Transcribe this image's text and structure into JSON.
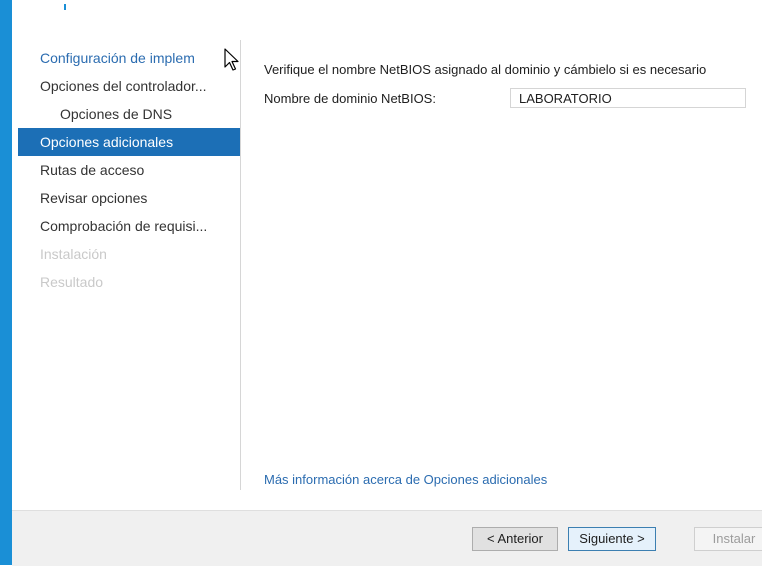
{
  "nav": {
    "items": [
      {
        "label": "Configuración de implem"
      },
      {
        "label": "Opciones del controlador..."
      },
      {
        "label": "Opciones de DNS"
      },
      {
        "label": "Opciones adicionales"
      },
      {
        "label": "Rutas de acceso"
      },
      {
        "label": "Revisar opciones"
      },
      {
        "label": "Comprobación de requisi..."
      },
      {
        "label": "Instalación"
      },
      {
        "label": "Resultado"
      }
    ]
  },
  "main": {
    "description": "Verifique el nombre NetBIOS asignado al dominio y cámbielo si es necesario",
    "netbios_label": "Nombre de dominio NetBIOS:",
    "netbios_value": "LABORATORIO",
    "help_link": "Más información acerca de Opciones adicionales"
  },
  "footer": {
    "back_label": "< Anterior",
    "next_label": "Siguiente >",
    "install_label": "Instalar"
  },
  "colors": {
    "accent": "#1a8fd6",
    "selected": "#1c6fb6",
    "link": "#2b6cb0"
  }
}
